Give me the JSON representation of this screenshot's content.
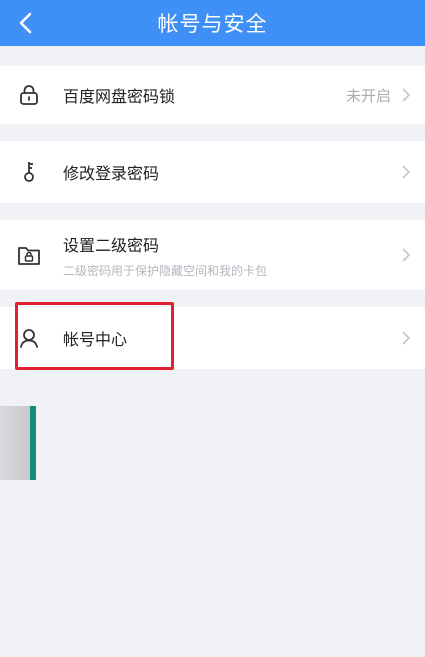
{
  "header": {
    "title": "帐号与安全"
  },
  "items": [
    {
      "label": "百度网盘密码锁",
      "status": "未开启",
      "icon": "lock-icon"
    },
    {
      "label": "修改登录密码",
      "icon": "key-icon"
    },
    {
      "label": "设置二级密码",
      "sublabel": "二级密码用于保护隐藏空间和我的卡包",
      "icon": "folder-lock-icon"
    },
    {
      "label": "帐号中心",
      "icon": "user-icon"
    }
  ],
  "colors": {
    "header_bg": "#3e8ff6",
    "highlight": "#e3202f",
    "side_bar": "#178b7c"
  }
}
